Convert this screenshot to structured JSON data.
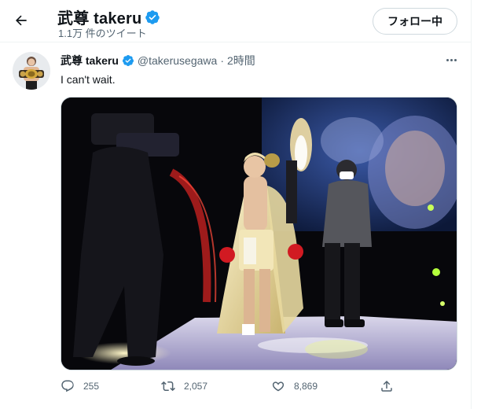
{
  "header": {
    "title": "武尊 takeru",
    "tweet_count": "1.1万 件のツイート",
    "follow_label": "フォロー中"
  },
  "tweet": {
    "author_name": "武尊 takeru",
    "handle": "@takerusegawa",
    "separator": "·",
    "time": "2時間",
    "text": "I can't wait."
  },
  "stats": {
    "replies": "255",
    "retweets": "2,057",
    "likes": "8,869"
  },
  "icons": {
    "back": "arrow-left-icon",
    "verified": "verified-badge-icon",
    "more": "more-horizontal-icon",
    "reply": "reply-icon",
    "retweet": "retweet-icon",
    "like": "heart-icon",
    "share": "share-icon"
  },
  "colors": {
    "verified": "#1d9bf0",
    "text_primary": "#0f1419",
    "text_secondary": "#536471",
    "border": "#eff3f4"
  }
}
